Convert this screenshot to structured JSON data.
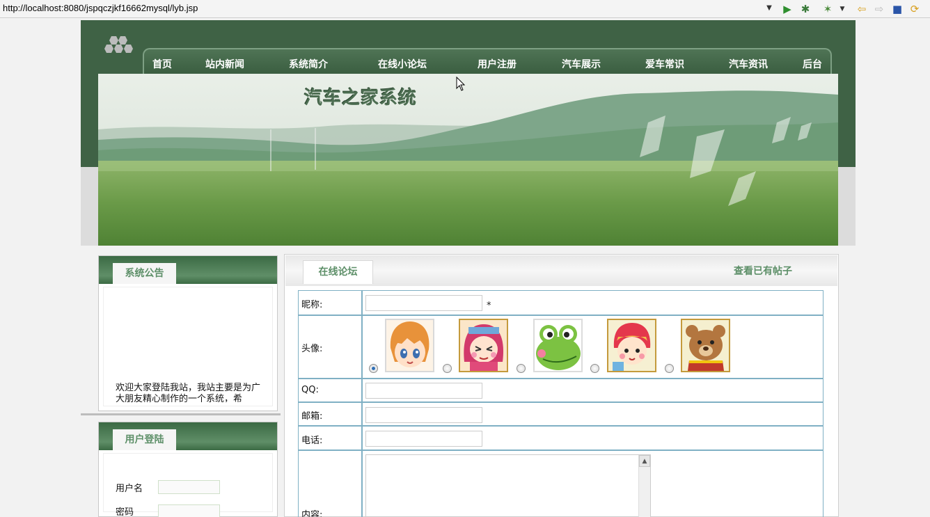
{
  "browser": {
    "url": "http://localhost:8080/jspqczjkf16662mysql/lyb.jsp"
  },
  "site": {
    "title": "汽车之家系统",
    "nav": [
      "首页",
      "站内新闻",
      "系统简介",
      "在线小论坛",
      "用户注册",
      "汽车展示",
      "爱车常识",
      "汽车资讯",
      "后台"
    ]
  },
  "notice": {
    "heading": "系统公告",
    "text": "欢迎大家登陆我站，我站主要是为广大朋友精心制作的一个系统，希"
  },
  "login": {
    "heading": "用户登陆",
    "username_label": "用户名",
    "password_label": "密码"
  },
  "forum": {
    "tab": "在线论坛",
    "view_posts": "查看已有帖子",
    "labels": {
      "nickname": "昵称:",
      "avatar": "头像:",
      "qq": "QQ:",
      "email": "邮箱:",
      "phone": "电话:",
      "content": "内容:"
    },
    "required_mark": "*",
    "selected_avatar": 0
  }
}
